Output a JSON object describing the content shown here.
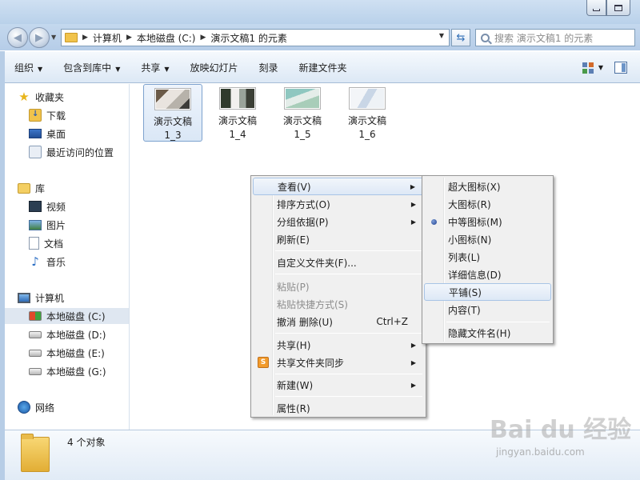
{
  "address_bar": {
    "breadcrumbs": [
      "计算机",
      "本地磁盘 (C:)",
      "演示文稿1 的元素"
    ]
  },
  "search": {
    "placeholder": "搜索 演示文稿1 的元素"
  },
  "toolbar": {
    "organize": "组织",
    "include_in_library": "包含到库中",
    "share": "共享",
    "slideshow": "放映幻灯片",
    "burn": "刻录",
    "new_folder": "新建文件夹"
  },
  "nav": {
    "favorites": "收藏夹",
    "downloads": "下载",
    "desktop": "桌面",
    "recent": "最近访问的位置",
    "libraries": "库",
    "videos": "视频",
    "pictures": "图片",
    "documents": "文档",
    "music": "音乐",
    "computer": "计算机",
    "drive_c": "本地磁盘 (C:)",
    "drive_d": "本地磁盘 (D:)",
    "drive_e": "本地磁盘 (E:)",
    "drive_g": "本地磁盘 (G:)",
    "network": "网络"
  },
  "files": [
    {
      "line1": "演示文稿",
      "line2": "1_3",
      "selected": true
    },
    {
      "line1": "演示文稿",
      "line2": "1_4",
      "selected": false
    },
    {
      "line1": "演示文稿",
      "line2": "1_5",
      "selected": false
    },
    {
      "line1": "演示文稿",
      "line2": "1_6",
      "selected": false
    }
  ],
  "status": {
    "count": "4 个对象"
  },
  "context_menu": {
    "view": "查看(V)",
    "sort_by": "排序方式(O)",
    "group_by": "分组依据(P)",
    "refresh": "刷新(E)",
    "customize": "自定义文件夹(F)...",
    "paste": "粘贴(P)",
    "paste_shortcut": "粘贴快捷方式(S)",
    "undo_delete": "撤消 删除(U)",
    "undo_shortcut": "Ctrl+Z",
    "share_with": "共享(H)",
    "share_sync": "共享文件夹同步",
    "sync_icon_letter": "S",
    "new": "新建(W)",
    "properties": "属性(R)"
  },
  "view_submenu": {
    "extra_large": "超大图标(X)",
    "large": "大图标(R)",
    "medium": "中等图标(M)",
    "small": "小图标(N)",
    "list": "列表(L)",
    "details": "详细信息(D)",
    "tiles": "平铺(S)",
    "content": "内容(T)",
    "hide_names": "隐藏文件名(H)",
    "checked": "medium",
    "highlighted": "tiles"
  },
  "watermark": {
    "logo": "Bai du 经验",
    "url": "jingyan.baidu.com"
  }
}
